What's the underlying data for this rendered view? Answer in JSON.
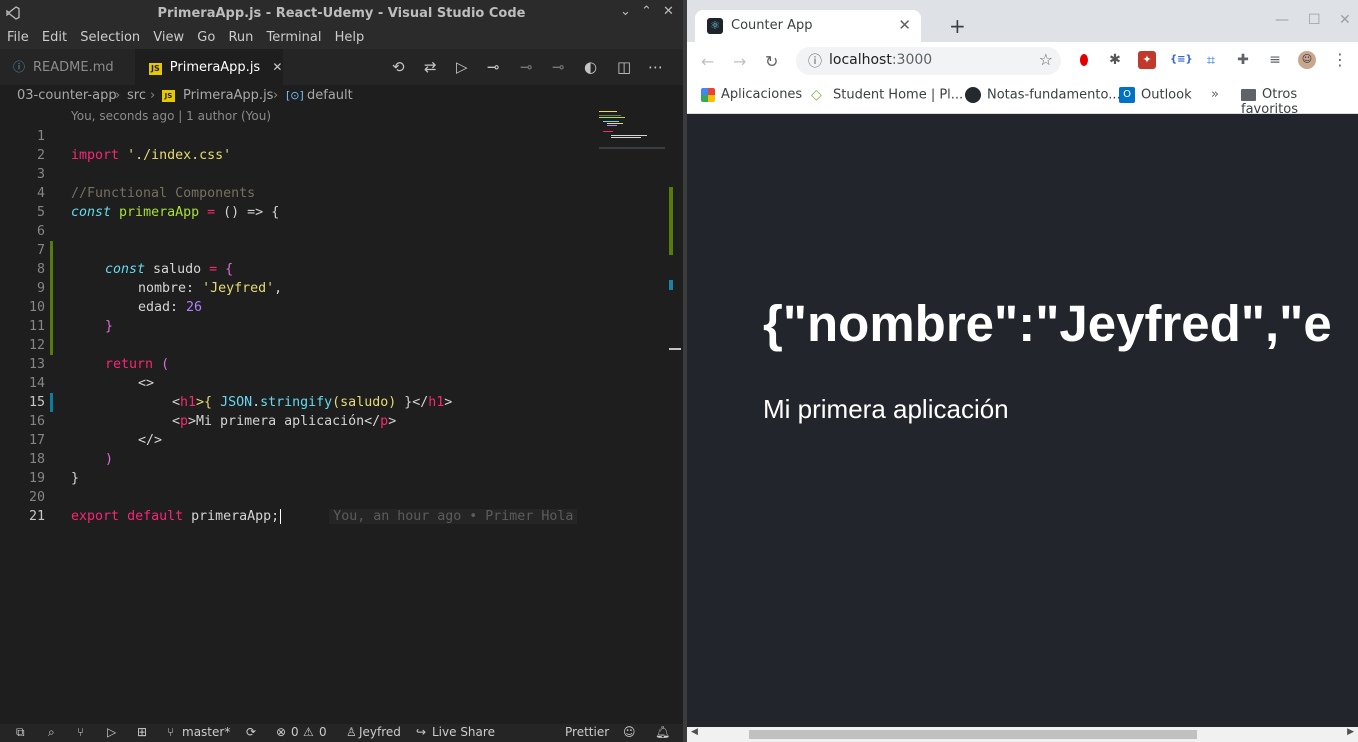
{
  "vscode": {
    "window_title": "PrimeraApp.js - React-Udemy - Visual Studio Code",
    "menu": [
      "File",
      "Edit",
      "Selection",
      "View",
      "Go",
      "Run",
      "Terminal",
      "Help"
    ],
    "tabs": [
      {
        "label": "README.md",
        "icon": "info-icon"
      },
      {
        "label": "PrimeraApp.js",
        "icon": "js-file-icon",
        "close": "✕"
      }
    ],
    "breadcrumb": [
      "03-counter-app",
      "src",
      "PrimeraApp.js",
      "default"
    ],
    "codelens": "You, seconds ago | 1 author (You)",
    "lines": [
      "1",
      "2",
      "3",
      "4",
      "5",
      "6",
      "7",
      "8",
      "9",
      "10",
      "11",
      "12",
      "13",
      "14",
      "15",
      "16",
      "17",
      "18",
      "19",
      "20",
      "21"
    ],
    "code": {
      "l2a": "import",
      "l2b": "'./index.css'",
      "l4": "//Functional Components",
      "l5a": "const",
      "l5b": "primeraApp",
      "l5c": "=",
      "l5d": "() =>",
      "l5e": "{",
      "l8a": "const",
      "l8b": "saludo",
      "l8c": "=",
      "l8d": "{",
      "l9a": "nombre:",
      "l9b": "'Jeyfred'",
      "l9c": ",",
      "l10a": "edad:",
      "l10b": "26",
      "l11": "}",
      "l13a": "return",
      "l13b": "(",
      "l14": "<>",
      "l15a": "<",
      "l15b": "h1",
      "l15c": ">{ ",
      "l15d": "JSON",
      "l15e": ".",
      "l15f": "stringify",
      "l15g": "(saludo)",
      "l15h": " }</",
      "l15i": "h1",
      "l15j": ">",
      "l16a": "<",
      "l16b": "p",
      "l16c": ">Mi primera aplicación</",
      "l16d": "p",
      "l16e": ">",
      "l17": "</>",
      "l18": ")",
      "l19": "}",
      "l21a": "export",
      "l21b": "default",
      "l21c": "primeraApp;",
      "blame": "You, an hour ago • Primer Hola"
    },
    "status": {
      "branch": "master*",
      "errors": "0",
      "warnings": "0",
      "user": "Jeyfred",
      "live_share": "Live Share",
      "formatter": "Prettier"
    }
  },
  "browser": {
    "tab_title": "Counter App",
    "url_host": "localhost",
    "url_port": ":3000",
    "bookmarks": [
      "Aplicaciones",
      "Student Home | Pl...",
      "Notas-fundamento...",
      "Outlook"
    ],
    "more_bookmarks": "»",
    "other_favorites": "Otros favoritos",
    "page": {
      "heading": "{\"nombre\":\"Jeyfred\",\"e",
      "paragraph": "Mi primera aplicación"
    }
  }
}
